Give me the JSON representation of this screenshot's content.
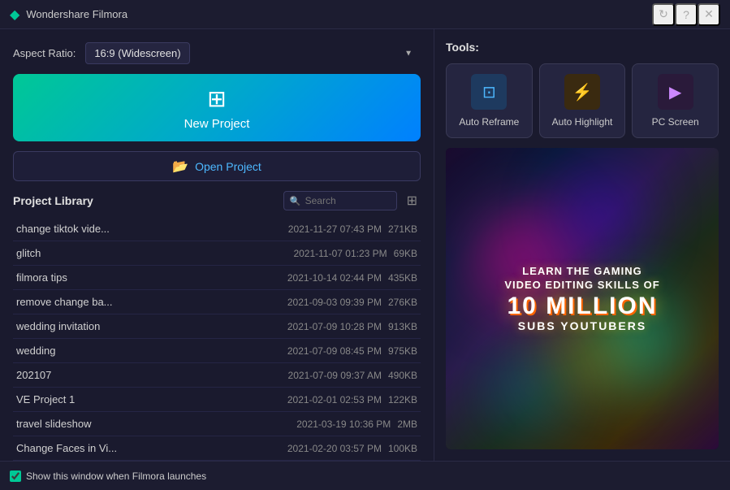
{
  "app": {
    "title": "Wondershare Filmora",
    "icon": "🎬"
  },
  "titlebar": {
    "minimize_label": "—",
    "maximize_label": "□",
    "close_label": "✕",
    "help_label": "?",
    "refresh_label": "↻"
  },
  "left": {
    "aspect_label": "Aspect Ratio:",
    "aspect_value": "16:9 (Widescreen)",
    "new_project_label": "New Project",
    "open_project_label": "Open Project",
    "library_title": "Project Library",
    "search_placeholder": "Search",
    "projects": [
      {
        "name": "change tiktok vide...",
        "date": "2021-11-27 07:43 PM",
        "size": "271KB"
      },
      {
        "name": "glitch",
        "date": "2021-11-07 01:23 PM",
        "size": "69KB"
      },
      {
        "name": "filmora tips",
        "date": "2021-10-14 02:44 PM",
        "size": "435KB"
      },
      {
        "name": "remove change ba...",
        "date": "2021-09-03 09:39 PM",
        "size": "276KB"
      },
      {
        "name": "wedding invitation",
        "date": "2021-07-09 10:28 PM",
        "size": "913KB"
      },
      {
        "name": "wedding",
        "date": "2021-07-09 08:45 PM",
        "size": "975KB"
      },
      {
        "name": "202107",
        "date": "2021-07-09 09:37 AM",
        "size": "490KB"
      },
      {
        "name": "VE Project 1",
        "date": "2021-02-01 02:53 PM",
        "size": "122KB"
      },
      {
        "name": "travel slideshow",
        "date": "2021-03-19 10:36 PM",
        "size": "2MB"
      },
      {
        "name": "Change Faces in Vi...",
        "date": "2021-02-20 03:57 PM",
        "size": "100KB"
      }
    ]
  },
  "right": {
    "tools_label": "Tools:",
    "tools": [
      {
        "id": "auto-reframe",
        "label": "Auto Reframe",
        "icon": "⊞",
        "icon_class": "icon-reframe"
      },
      {
        "id": "auto-highlight",
        "label": "Auto Highlight",
        "icon": "⚡",
        "icon_class": "icon-highlight"
      },
      {
        "id": "pc-screen",
        "label": "PC Screen",
        "icon": "▶",
        "icon_class": "icon-screen"
      }
    ],
    "preview": {
      "line1": "LEARN THE GAMING\nVIDEO EDITING SKILLS OF",
      "line2": "10 MILLION",
      "line3": "SUBS YOUTUBERS"
    }
  },
  "bottom": {
    "checkbox_label": "Show this window when Filmora launches",
    "checked": true
  }
}
